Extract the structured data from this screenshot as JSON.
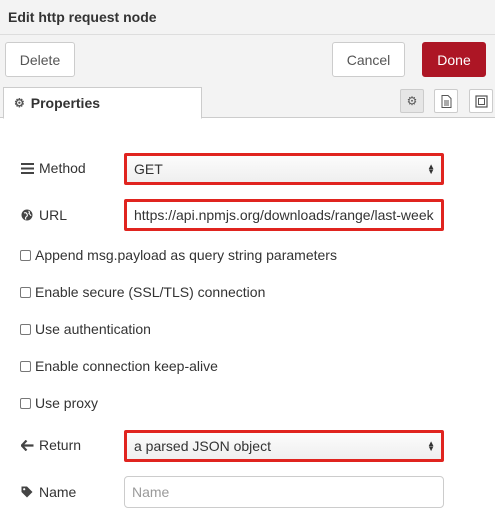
{
  "dialog": {
    "title": "Edit http request node"
  },
  "toolbar": {
    "delete_label": "Delete",
    "cancel_label": "Cancel",
    "done_label": "Done"
  },
  "tabs": {
    "properties_label": "Properties",
    "icons": [
      "gear-icon",
      "document-icon",
      "frame-icon"
    ]
  },
  "form": {
    "method": {
      "label": "Method",
      "icon": "list-icon",
      "value": "GET"
    },
    "url": {
      "label": "URL",
      "icon": "globe-icon",
      "value": "https://api.npmjs.org/downloads/range/last-week"
    },
    "checkboxes": [
      {
        "label": "Append msg.payload as query string parameters",
        "checked": false
      },
      {
        "label": "Enable secure (SSL/TLS) connection",
        "checked": false
      },
      {
        "label": "Use authentication",
        "checked": false
      },
      {
        "label": "Enable connection keep-alive",
        "checked": false
      },
      {
        "label": "Use proxy",
        "checked": false
      }
    ],
    "return": {
      "label": "Return",
      "icon": "arrow-left-icon",
      "value": "a parsed JSON object"
    },
    "name": {
      "label": "Name",
      "icon": "tag-icon",
      "placeholder": "Name",
      "value": ""
    }
  },
  "colors": {
    "accent_done": "#ad1625",
    "highlight_border": "#e0241f"
  }
}
